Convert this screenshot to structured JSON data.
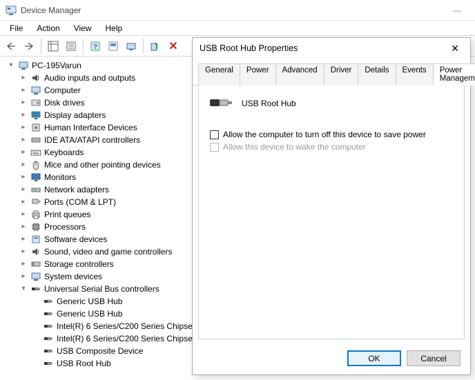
{
  "window": {
    "title": "Device Manager"
  },
  "menu": {
    "file": "File",
    "action": "Action",
    "view": "View",
    "help": "Help"
  },
  "tree": {
    "root": "PC-195Varun",
    "categories": [
      "Audio inputs and outputs",
      "Computer",
      "Disk drives",
      "Display adapters",
      "Human Interface Devices",
      "IDE ATA/ATAPI controllers",
      "Keyboards",
      "Mice and other pointing devices",
      "Monitors",
      "Network adapters",
      "Ports (COM & LPT)",
      "Print queues",
      "Processors",
      "Software devices",
      "Sound, video and game controllers",
      "Storage controllers",
      "System devices",
      "Universal Serial Bus controllers"
    ],
    "usb_children": [
      "Generic USB Hub",
      "Generic USB Hub",
      "Intel(R) 6 Series/C200 Series Chipse",
      "Intel(R) 6 Series/C200 Series Chipse",
      "USB Composite Device",
      "USB Root Hub"
    ]
  },
  "dialog": {
    "title": "USB Root Hub Properties",
    "tabs": {
      "general": "General",
      "power": "Power",
      "advanced": "Advanced",
      "driver": "Driver",
      "details": "Details",
      "events": "Events",
      "power_mgmt": "Power Management"
    },
    "device_name": "USB Root Hub",
    "chk_turnoff": "Allow the computer to turn off this device to save power",
    "chk_wake": "Allow this device to wake the computer",
    "ok": "OK",
    "cancel": "Cancel"
  }
}
